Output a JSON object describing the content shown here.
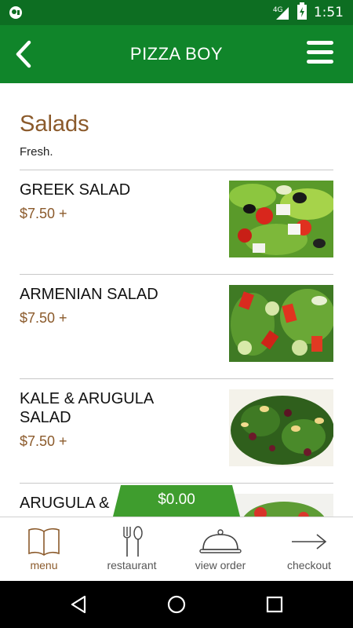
{
  "status_bar": {
    "time": "1:51",
    "network": "4G"
  },
  "app_bar": {
    "title": "PIZZA BOY"
  },
  "section": {
    "title": "Salads",
    "subtitle": "Fresh."
  },
  "items": [
    {
      "name": "GREEK SALAD",
      "price": "$7.50 +"
    },
    {
      "name": "ARMENIAN SALAD",
      "price": "$7.50 +"
    },
    {
      "name": "KALE & ARUGULA SALAD",
      "price": "$7.50 +"
    },
    {
      "name": "ARUGULA &",
      "price": ""
    }
  ],
  "cart": {
    "total": "$0.00"
  },
  "bottom_nav": [
    {
      "label": "menu",
      "icon": "book-icon",
      "active": true
    },
    {
      "label": "restaurant",
      "icon": "fork-knife-icon",
      "active": false
    },
    {
      "label": "view order",
      "icon": "cloche-icon",
      "active": false
    },
    {
      "label": "checkout",
      "icon": "arrow-right-icon",
      "active": false
    }
  ],
  "colors": {
    "app_bar": "#10852a",
    "status_bar": "#0d6e22",
    "accent": "#8b5a2b",
    "cart_tab": "#3f9d2e"
  }
}
